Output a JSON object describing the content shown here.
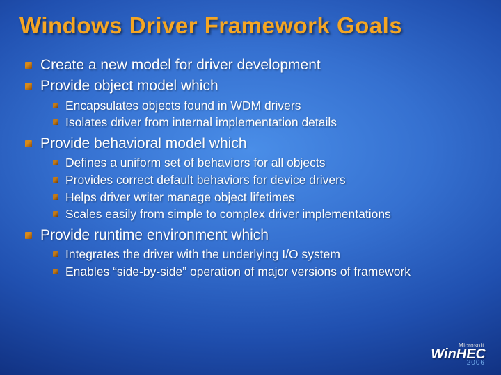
{
  "title": "Windows Driver Framework Goals",
  "bullets": [
    {
      "text": "Create a new model for driver development",
      "children": []
    },
    {
      "text": "Provide object model which",
      "children": [
        "Encapsulates objects found in WDM drivers",
        "Isolates driver from internal implementation details"
      ]
    },
    {
      "text": "Provide behavioral model which",
      "children": [
        "Defines a uniform set of behaviors for all objects",
        "Provides correct default behaviors for device drivers",
        "Helps driver writer manage object lifetimes",
        "Scales easily from simple to complex driver implementations"
      ]
    },
    {
      "text": "Provide runtime environment which",
      "children": [
        "Integrates the driver with the underlying I/O system",
        "Enables “side-by-side” operation of major versions of framework"
      ]
    }
  ],
  "footer": {
    "company": "Microsoft",
    "brand_prefix": "Win",
    "brand_suffix": "HEC",
    "year": "2006"
  }
}
